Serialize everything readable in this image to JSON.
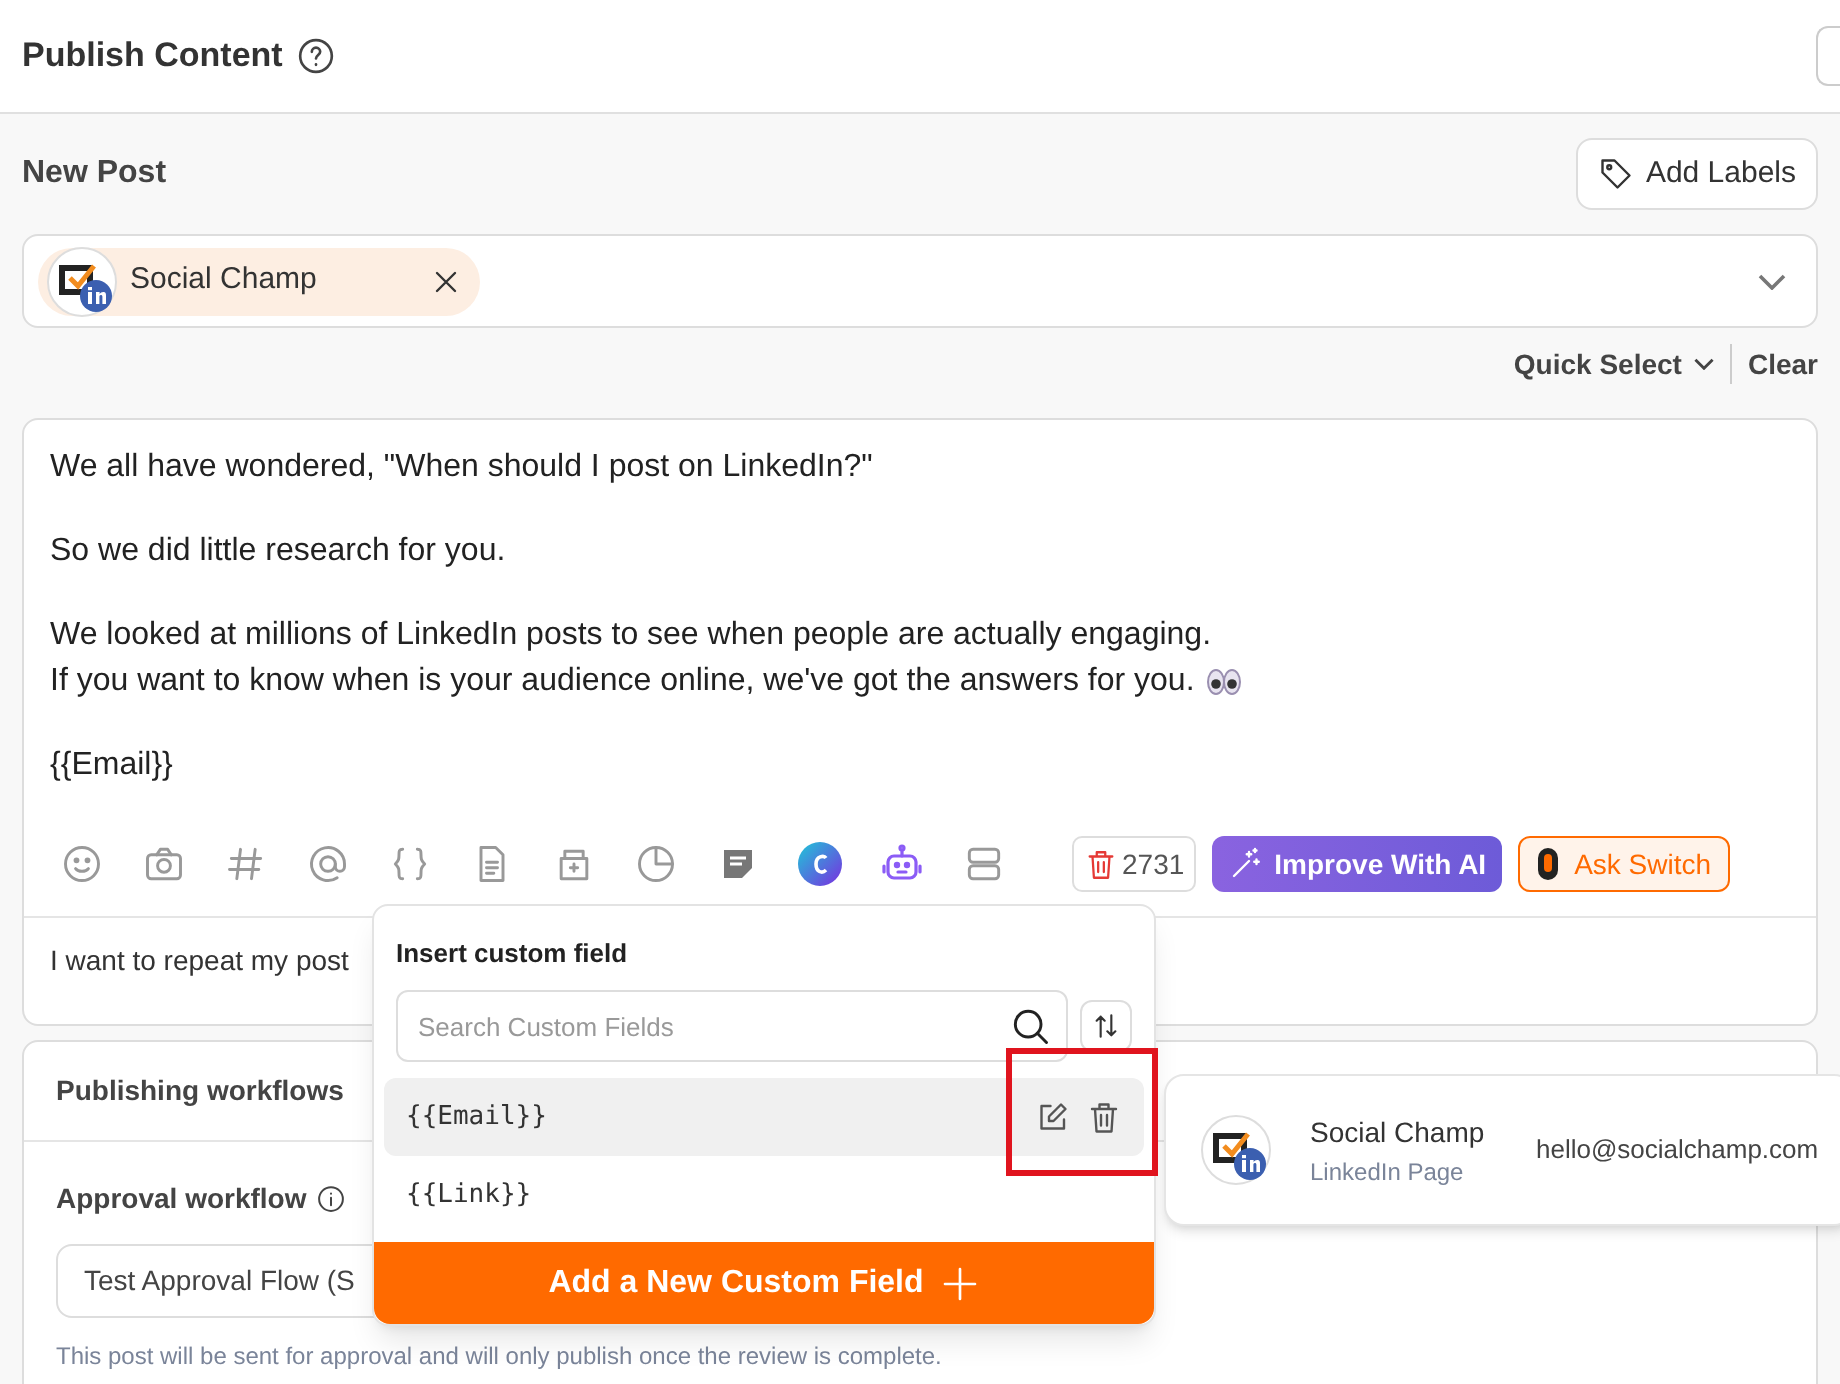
{
  "header": {
    "title": "Publish Content"
  },
  "post": {
    "title": "New Post",
    "add_labels": "Add Labels"
  },
  "accounts": [
    {
      "name": "Social Champ"
    }
  ],
  "quick_select": "Quick Select",
  "clear": "Clear",
  "editor": {
    "paragraphs": [
      [
        "We all have wondered, \"When should I post on LinkedIn?\""
      ],
      [
        "So we did little research for you."
      ],
      [
        "We looked at millions of LinkedIn posts to see when people are actually engaging.",
        "If you want to know when is your audience online, we've got the answers for you."
      ],
      [
        "{{Email}}"
      ]
    ],
    "char_count": "2731",
    "improve_button": "Improve With AI",
    "ask_button": "Ask Switch",
    "repeat_text": "I want to repeat my post"
  },
  "workflows": {
    "title": "Publishing workflows",
    "approval_label": "Approval workflow",
    "approval_value": "Test Approval Flow (S",
    "note": "This post will be sent for approval and will only publish once the review is complete."
  },
  "custom_field_menu": {
    "title": "Insert custom field",
    "search_placeholder": "Search Custom Fields",
    "fields": [
      {
        "label": "{{Email}}",
        "selected": true
      },
      {
        "label": "{{Link}}",
        "selected": false
      }
    ],
    "add_button": "Add a New Custom Field"
  },
  "profile_card": {
    "name": "Social Champ",
    "type": "LinkedIn Page",
    "email": "hello@socialchamp.com"
  }
}
